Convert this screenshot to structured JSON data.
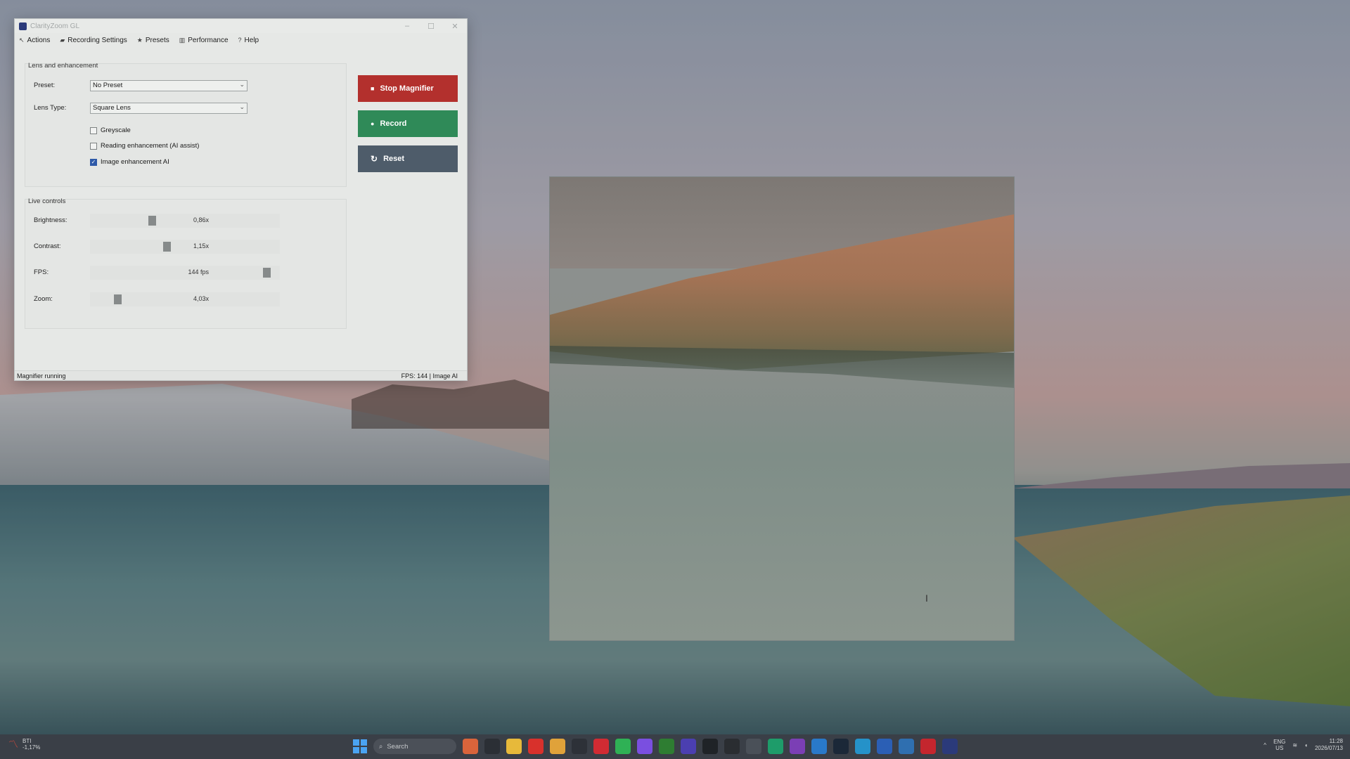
{
  "window": {
    "title": "ClarityZoom GL",
    "controls": [
      "–",
      "☐",
      "✕"
    ]
  },
  "menu": [
    {
      "icon": "↖",
      "label": "Actions"
    },
    {
      "icon": "▰",
      "label": "Recording Settings"
    },
    {
      "icon": "★",
      "label": "Presets"
    },
    {
      "icon": "▥",
      "label": "Performance"
    },
    {
      "icon": "?",
      "label": "Help"
    }
  ],
  "lens_group": {
    "title": "Lens and enhancement",
    "preset_label": "Preset:",
    "preset_value": "No Preset",
    "lens_type_label": "Lens Type:",
    "lens_type_value": "Square Lens",
    "checkboxes": [
      {
        "label": "Greyscale",
        "checked": false
      },
      {
        "label": "Reading enhancement (AI assist)",
        "checked": false
      },
      {
        "label": "Image enhancement AI",
        "checked": true
      }
    ]
  },
  "buttons": {
    "stop": "Stop Magnifier",
    "record": "Record",
    "reset": "Reset"
  },
  "live_controls": {
    "title": "Live controls",
    "sliders": [
      {
        "label": "Brightness:",
        "value": "0,86x",
        "level": 0.32
      },
      {
        "label": "Contrast:",
        "value": "1,15x",
        "level": 0.4
      },
      {
        "label": "FPS:",
        "value": "144 fps",
        "level": 0.95
      },
      {
        "label": "Zoom:",
        "value": "4,03x",
        "level": 0.13
      }
    ]
  },
  "status": {
    "left": "Magnifier running",
    "right": "FPS: 144 | Image AI"
  },
  "taskbar": {
    "weather_name": "BTI",
    "weather_change": "-1,17%",
    "search_placeholder": "Search",
    "lang_top": "ENG",
    "lang_bottom": "US",
    "time": "11:28",
    "date": "2026/07/13",
    "icons": [
      {
        "name": "browser-widget-icon",
        "color": "#d9643b"
      },
      {
        "name": "file-manager-icon",
        "color": "#2b2f35"
      },
      {
        "name": "folder-icon",
        "color": "#e7b93a"
      },
      {
        "name": "youtube-icon",
        "color": "#d8312c"
      },
      {
        "name": "chrome-icon",
        "color": "#e0a23a"
      },
      {
        "name": "app-dark-icon",
        "color": "#2d3138"
      },
      {
        "name": "opera-icon",
        "color": "#d12b33"
      },
      {
        "name": "whatsapp-icon",
        "color": "#2fb155"
      },
      {
        "name": "messenger-icon",
        "color": "#7a4fe0"
      },
      {
        "name": "xbox-icon",
        "color": "#2e7d32"
      },
      {
        "name": "visual-studio-icon",
        "color": "#4b3fb0"
      },
      {
        "name": "terminal-icon",
        "color": "#1f2327"
      },
      {
        "name": "cmd-icon",
        "color": "#2a2d31"
      },
      {
        "name": "paint-icon",
        "color": "#4a5058"
      },
      {
        "name": "pycharm-icon",
        "color": "#1e9c6a"
      },
      {
        "name": "onenote-icon",
        "color": "#7b3fb5"
      },
      {
        "name": "monitor-icon",
        "color": "#2979c9"
      },
      {
        "name": "steam-icon",
        "color": "#1b2838"
      },
      {
        "name": "edge-icon",
        "color": "#2592c9"
      },
      {
        "name": "word-icon",
        "color": "#2b5fb5"
      },
      {
        "name": "photos-icon",
        "color": "#2f6fb0"
      },
      {
        "name": "acrobat-icon",
        "color": "#c4262e"
      },
      {
        "name": "clarityzoom-icon",
        "color": "#2b3a7a"
      }
    ]
  }
}
